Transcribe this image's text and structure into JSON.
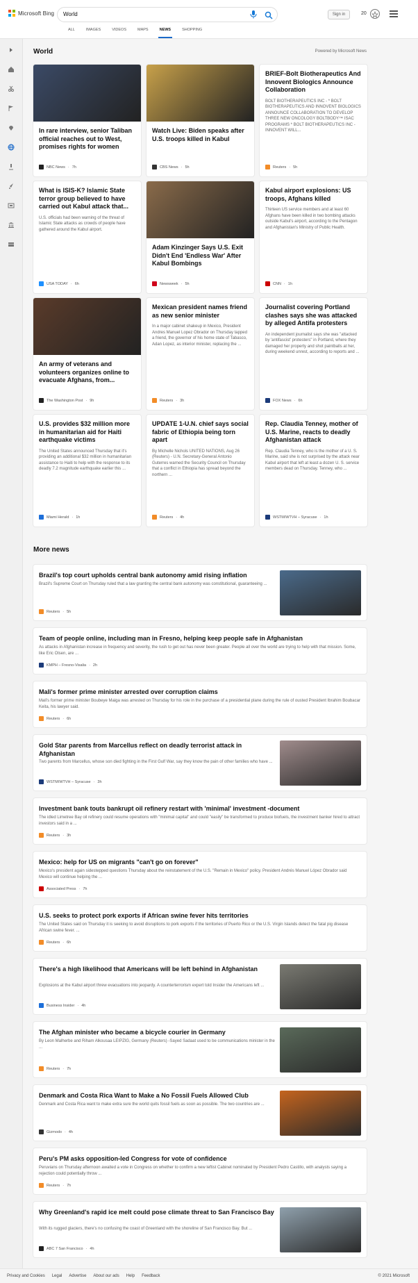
{
  "header": {
    "logo_text": "Microsoft Bing",
    "search_value": "World",
    "signin_label": "Sign in",
    "rewards_count": "20",
    "tabs": [
      {
        "label": "ALL"
      },
      {
        "label": "IMAGES"
      },
      {
        "label": "VIDEOS"
      },
      {
        "label": "MAPS"
      },
      {
        "label": "NEWS"
      },
      {
        "label": "SHOPPING"
      }
    ]
  },
  "world": {
    "title": "World",
    "powered_by": "Powered by Microsoft News",
    "cards": [
      {
        "title": "In rare interview, senior Taliban official reaches out to West, promises rights for women",
        "snippet": "",
        "source": "NBC News",
        "age": "7h",
        "src_color": "#222222",
        "img_color": "#3b4a66"
      },
      {
        "title": "Watch Live: Biden speaks after U.S. troops killed in Kabul",
        "snippet": "",
        "source": "CBS News",
        "age": "5h",
        "src_color": "#333333",
        "img_color": "#c8a14a"
      },
      {
        "title": "BRIEF-Bolt Biotherapeutics And Innovent Biologics Announce Collaboration",
        "snippet": "BOLT BIOTHERAPEUTICS INC - * BOLT BIOTHERAPEUTICS AND INNOVENT BIOLOGICS ANNOUNCE COLLABORATION TO DEVELOP THREE NEW ONCOLOGY BOLTBODY™ ISAC PROGRAMS * BOLT BIOTHERAPEUTICS INC - INNOVENT WILL...",
        "source": "Reuters",
        "age": "5h",
        "src_color": "#f28c28",
        "img_color": ""
      },
      {
        "title": "What is ISIS-K? Islamic State terror group believed to have carried out Kabul attack that...",
        "snippet": "U.S. officials had been warning of the threat of Islamic State attacks as crowds of people have gathered around the Kabul airport.",
        "source": "USA TODAY",
        "age": "6h",
        "src_color": "#1e90ff",
        "img_color": ""
      },
      {
        "title": "Adam Kinzinger Says U.S. Exit Didn't End 'Endless War' After Kabul Bombings",
        "snippet": "",
        "source": "Newsweek",
        "age": "5h",
        "src_color": "#d0021b",
        "img_color": "#8a6b4a"
      },
      {
        "title": "Kabul airport explosions: US troops, Afghans killed",
        "snippet": "Thirteen US service members and at least 60 Afghans have been killed in two bombing attacks outside Kabul's airport, according to the Pentagon and Afghanistan's Ministry of Public Health.",
        "source": "CNN",
        "age": "1h",
        "src_color": "#cc0000",
        "img_color": ""
      },
      {
        "title": "An army of veterans and volunteers organizes online to evacuate Afghans, from...",
        "snippet": "",
        "source": "The Washington Post",
        "age": "9h",
        "src_color": "#222222",
        "img_color": "#5a3b2a"
      },
      {
        "title": "Mexican president names friend as new senior minister",
        "snippet": "In a major cabinet shakeup in Mexico, President Andres Manuel Lopez Obrador on Thursday tapped a friend, the governor of his home state of Tabasco, Adan Lopez, as interior minister, replacing the ...",
        "source": "Reuters",
        "age": "3h",
        "src_color": "#f28c28",
        "img_color": ""
      },
      {
        "title": "Journalist covering Portland clashes says she was attacked by alleged Antifa protesters",
        "snippet": "An independent journalist says she was \"attacked by 'antifascist' protesters\" in Portland, where they damaged her property and shot paintballs at her, during weekend unrest, according to reports and ...",
        "source": "FOX News",
        "age": "6h",
        "src_color": "#1c3b7a",
        "img_color": ""
      },
      {
        "title": "U.S. provides $32 million more in humanitarian aid for Haiti earthquake victims",
        "snippet": "The United States announced Thursday that it's providing an additional $32 million in humanitarian assistance to Haiti to help with the response to its deadly 7.2 magnitude earthquake earlier this ...",
        "source": "Miami Herald",
        "age": "1h",
        "src_color": "#1e6fd9",
        "img_color": ""
      },
      {
        "title": "UPDATE 1-U.N. chief says social fabric of Ethiopia being torn apart",
        "snippet": "By Michelle Nichols UNITED NATIONS, Aug 26 (Reuters) - U.N. Secretary-General Antonio Guterres warned the Security Council on Thursday that a conflict in Ethiopia has spread beyond the northern ...",
        "source": "Reuters",
        "age": "4h",
        "src_color": "#f28c28",
        "img_color": ""
      },
      {
        "title": "Rep. Claudia Tenney, mother of U.S. Marine, reacts to deadly Afghanistan attack",
        "snippet": "Rep. Claudia Tenney, who is the mother of a U. S. Marine, said she is not surprised by the attack near Kabul airport that left at least a dozen U. S. service members dead on Thursday. Tenney, who ...",
        "source": "WSTM/WTVH – Syracuse",
        "age": "1h",
        "src_color": "#1c3b7a",
        "img_color": ""
      }
    ]
  },
  "more_news": {
    "title": "More news",
    "items": [
      {
        "title": "Brazil's top court upholds central bank autonomy amid rising inflation",
        "snippet": "Brazil's Supreme Court on Thursday ruled that a law granting the central bank autonomy was constitutional, guaranteeing ...",
        "source": "Reuters",
        "age": "5h",
        "src_color": "#f28c28",
        "thumb_color": "#4a6a8a"
      },
      {
        "title": "Team of people online, including man in Fresno, helping keep people safe in Afghanistan",
        "snippet": "As attacks in Afghanistan increase in frequency and severity, the rush to get out has never been greater. People all over the world are trying to help with that mission. Some, like Eric Olsen, are ...",
        "source": "KMPH – Fresno-Visalia",
        "age": "2h",
        "src_color": "#1c3b7a",
        "thumb_color": ""
      },
      {
        "title": "Mali's former prime minister arrested over corruption claims",
        "snippet": "Mali's former prime minister Boubeye Maiga was arrested on Thursday for his role in the purchase of a presidential plane during the rule of ousted President Ibrahim Boubacar Keita, his lawyer said.",
        "source": "Reuters",
        "age": "6h",
        "src_color": "#f28c28",
        "thumb_color": ""
      },
      {
        "title": "Gold Star parents from Marcellus reflect on deadly terrorist attack in Afghanistan",
        "snippet": "Two parents from Marcellus, whose son died fighting in the First Gulf War, say they know the pain of other families who have ...",
        "source": "WSTM/WTVH – Syracuse",
        "age": "3h",
        "src_color": "#1c3b7a",
        "thumb_color": "#a08c8c"
      },
      {
        "title": "Investment bank touts bankrupt oil refinery restart with 'minimal' investment -document",
        "snippet": "The idled Limetree Bay oil refinery could resume operations with \"minimal capital\" and could \"easily\" be transformed to produce biofuels, the investment banker hired to attract investors said in a ...",
        "source": "Reuters",
        "age": "3h",
        "src_color": "#f28c28",
        "thumb_color": ""
      },
      {
        "title": "Mexico: help for US on migrants \"can't go on forever\"",
        "snippet": "Mexico's president again sidestepped questions Thursday about the reinstatement of the U.S. \"Remain in Mexico\" policy. President Andrés Manuel López Obrador said Mexico will continue helping the ...",
        "source": "Associated Press",
        "age": "7h",
        "src_color": "#cc0000",
        "thumb_color": ""
      },
      {
        "title": "U.S. seeks to protect pork exports if African swine fever hits territories",
        "snippet": "The United States said on Thursday it is seeking to avoid disruptions to pork exports if the territories of Puerto Rico or the U.S. Virgin Islands detect the fatal pig disease African swine fever. ...",
        "source": "Reuters",
        "age": "6h",
        "src_color": "#f28c28",
        "thumb_color": ""
      },
      {
        "title": "There's a high likelihood that Americans will be left behind in Afghanistan",
        "snippet": "Explosions at the Kabul airport threw evacuations into jeopardy. A counterterrorism expert told Insider the Americans left ...",
        "source": "Business Insider",
        "age": "4h",
        "src_color": "#1e6fd9",
        "thumb_color": "#7a7a72"
      },
      {
        "title": "The Afghan minister who became a bicycle courier in Germany",
        "snippet": "By Leon Malherbe and Riham Alkousaa LEIPZIG, Germany (Reuters) -Sayed Sadaat used to be communications minister in the ...",
        "source": "Reuters",
        "age": "7h",
        "src_color": "#f28c28",
        "thumb_color": "#5a6a5a"
      },
      {
        "title": "Denmark and Costa Rica Want to Make a No Fossil Fuels Allowed Club",
        "snippet": "Denmark and Costa Rica want to make extra sure the world quits fossil fuels as soon as possible. The two countries are ...",
        "source": "Gizmodo",
        "age": "4h",
        "src_color": "#333333",
        "thumb_color": "#c4641e"
      },
      {
        "title": "Peru's PM asks opposition-led Congress for vote of confidence",
        "snippet": "Peruvians on Thursday afternoon awaited a vote in Congress on whether to confirm a new leftist Cabinet nominated by President Pedro Castillo, with analysts saying a rejection could potentially throw ...",
        "source": "Reuters",
        "age": "7h",
        "src_color": "#f28c28",
        "thumb_color": ""
      },
      {
        "title": "Why Greenland's rapid ice melt could pose climate threat to San Francisco Bay",
        "snippet": "With its rugged glaciers, there's no confusing the coast of Greenland with the shoreline of San Francisco Bay. But ...",
        "source": "ABC 7 San Francisco",
        "age": "4h",
        "src_color": "#222222",
        "thumb_color": "#8fa0ac"
      }
    ]
  },
  "footer": {
    "links": [
      "Privacy and Cookies",
      "Legal",
      "Advertise",
      "About our ads",
      "Help",
      "Feedback"
    ],
    "copyright": "© 2021 Microsoft"
  },
  "colors": {
    "accent": "#1b6ac9",
    "background": "#f5f5f5"
  }
}
